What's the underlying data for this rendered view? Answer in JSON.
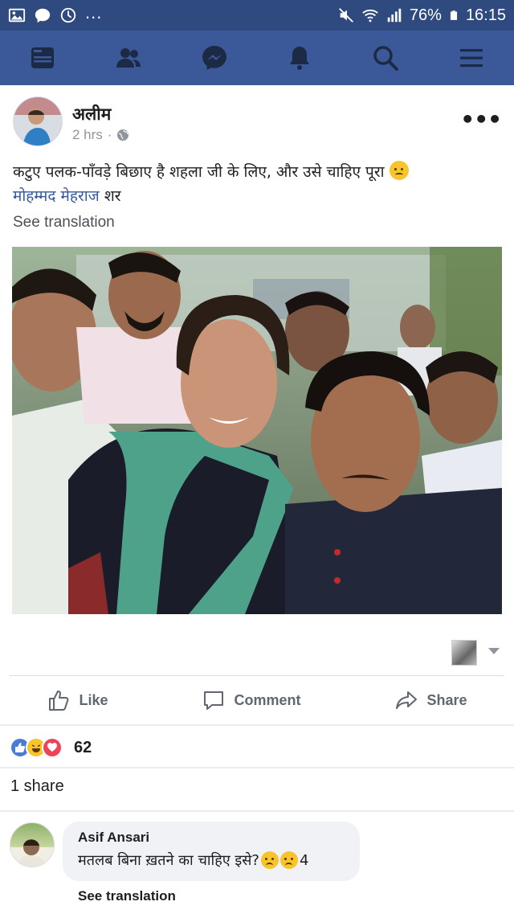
{
  "status_bar": {
    "overflow": "...",
    "battery": "76%",
    "time": "16:15",
    "icons": [
      "gallery-icon",
      "chat-bubble-icon",
      "sync-icon",
      "mute-icon",
      "wifi-icon",
      "signal-icon",
      "battery-icon"
    ]
  },
  "nav": {
    "items": [
      "news-feed-icon",
      "friends-icon",
      "messenger-icon",
      "notifications-icon",
      "search-icon",
      "menu-icon"
    ],
    "bar_color": "#3b5998"
  },
  "post": {
    "author": "अलीम",
    "time": "2 hrs",
    "separator": "·",
    "text_line1": "कटुए पलक-पाँवड़े बिछाए है शहला जी के लिए, और उसे चाहिए पूरा ",
    "mention": "मोहम्मद मेहराज",
    "text_line2_rest": " शर",
    "see_translation": "See translation"
  },
  "actions": {
    "like": "Like",
    "comment": "Comment",
    "share": "Share"
  },
  "reactions": {
    "count": "62",
    "types": [
      "like",
      "haha",
      "love"
    ]
  },
  "shares": "1 share",
  "comment": {
    "name": "Asif Ansari",
    "text": "मतलब बिना ख़तने का चाहिए इसे?",
    "reaction_count": "4",
    "see_translation": "See translation"
  },
  "colors": {
    "status_bar": "#2f4a7f",
    "link": "#365899",
    "meta": "#90949c"
  }
}
